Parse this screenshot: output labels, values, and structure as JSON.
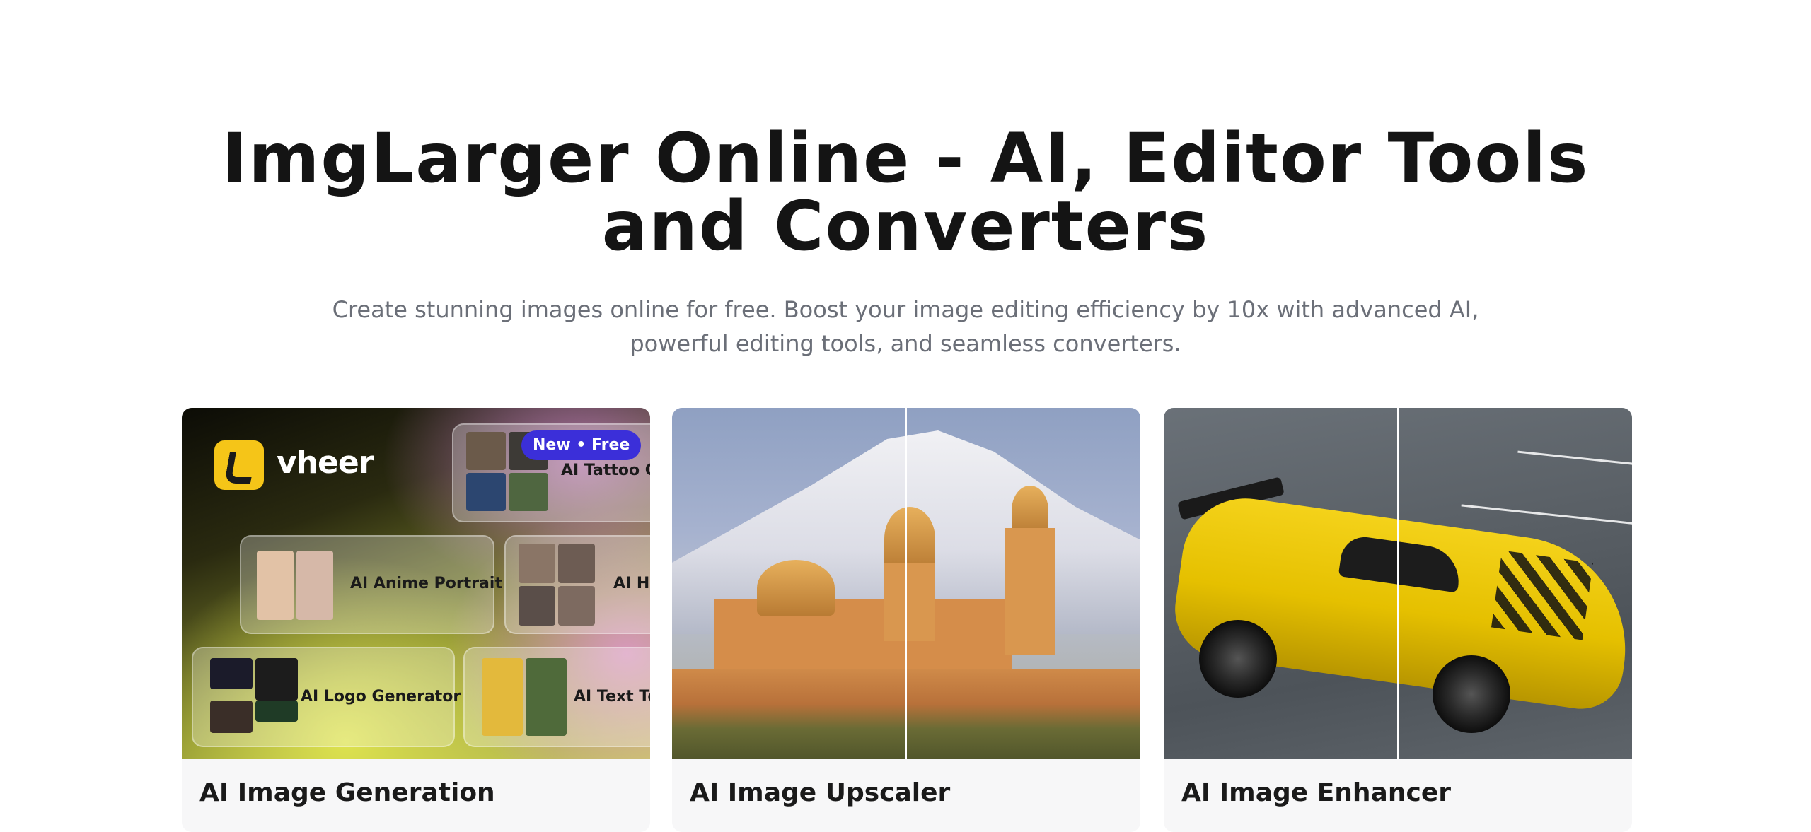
{
  "hero": {
    "title_line1": "ImgLarger Online - AI, Editor Tools",
    "title_line2": "and Converters",
    "subtitle_line1": "Create stunning images online for free. Boost your image editing efficiency by 10x with advanced AI,",
    "subtitle_line2": "powerful editing tools, and seamless converters."
  },
  "cards": [
    {
      "title": "AI Image Generation",
      "badge": "New • Free",
      "brand": "vheer",
      "tiles": [
        "AI Tattoo Ge",
        "AI Anime Portrait",
        "AI He",
        "AI Logo Generator",
        "AI Text To I"
      ]
    },
    {
      "title": "AI Image Upscaler"
    },
    {
      "title": "AI Image Enhancer"
    }
  ],
  "colors": {
    "badge": "#3b2fd9",
    "title_text": "#141414",
    "subtitle_text": "#6b6f78",
    "card_bg": "#f7f7f8"
  }
}
